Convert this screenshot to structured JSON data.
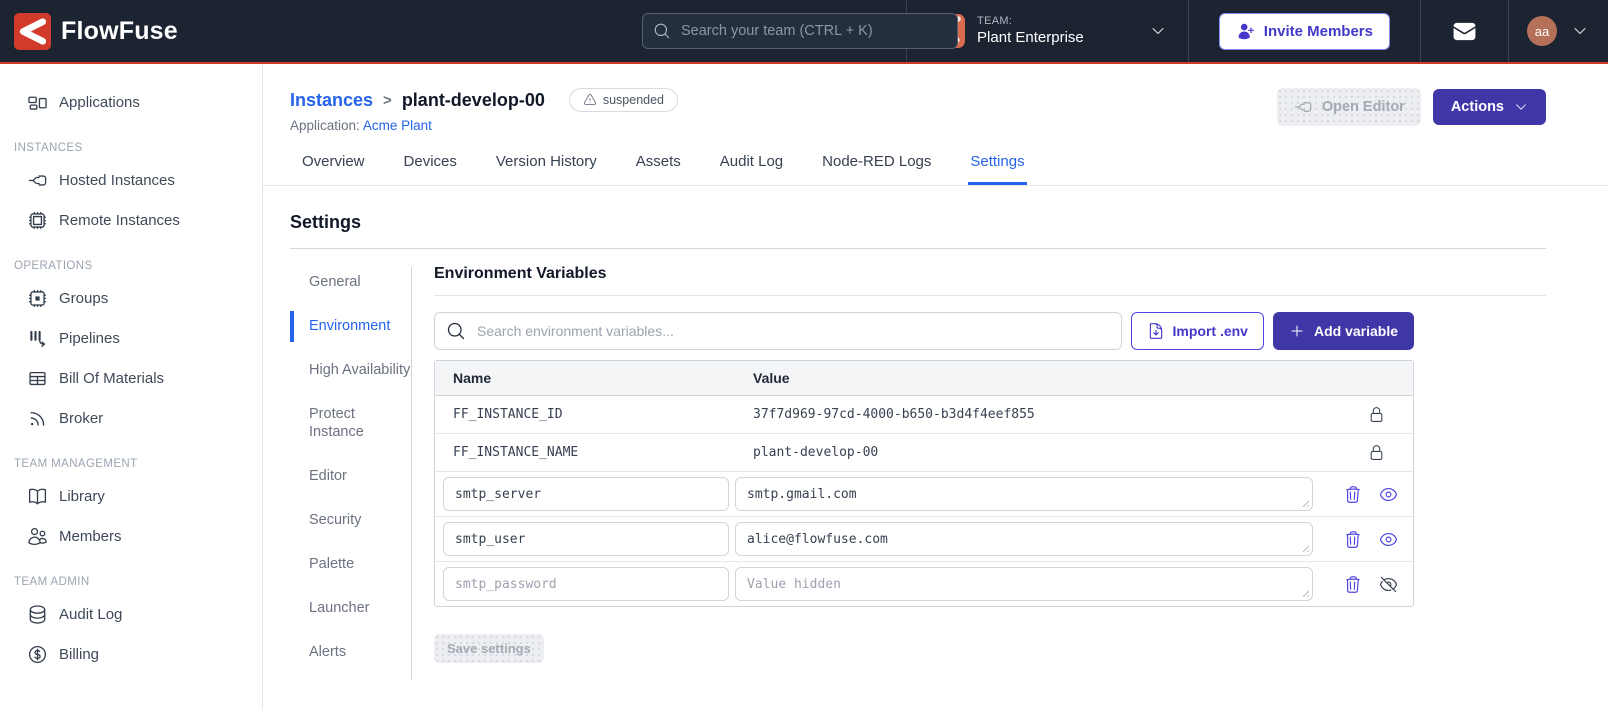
{
  "header": {
    "brand": "FlowFuse",
    "search_placeholder": "Search your team (CTRL + K)",
    "team_label": "TEAM:",
    "team_name": "Plant Enterprise",
    "invite_button": "Invite Members",
    "avatar_initials": "aa"
  },
  "sidebar": {
    "sections": [
      {
        "label": "",
        "items": [
          {
            "label": "Applications",
            "icon": "applications-icon"
          }
        ]
      },
      {
        "label": "INSTANCES",
        "items": [
          {
            "label": "Hosted Instances",
            "icon": "hosted-instances-icon"
          },
          {
            "label": "Remote Instances",
            "icon": "remote-instances-icon"
          }
        ]
      },
      {
        "label": "OPERATIONS",
        "items": [
          {
            "label": "Groups",
            "icon": "groups-icon"
          },
          {
            "label": "Pipelines",
            "icon": "pipelines-icon"
          },
          {
            "label": "Bill Of Materials",
            "icon": "bill-of-materials-icon"
          },
          {
            "label": "Broker",
            "icon": "broker-icon"
          }
        ]
      },
      {
        "label": "TEAM MANAGEMENT",
        "items": [
          {
            "label": "Library",
            "icon": "library-icon"
          },
          {
            "label": "Members",
            "icon": "members-icon"
          }
        ]
      },
      {
        "label": "TEAM ADMIN",
        "items": [
          {
            "label": "Audit Log",
            "icon": "audit-log-icon"
          },
          {
            "label": "Billing",
            "icon": "billing-icon"
          }
        ]
      }
    ]
  },
  "page": {
    "breadcrumb_parent": "Instances",
    "breadcrumb_separator": ">",
    "breadcrumb_current": "plant-develop-00",
    "status_badge": "suspended",
    "application_label": "Application:",
    "application_name": "Acme Plant",
    "open_editor_button": "Open Editor",
    "actions_button": "Actions",
    "tabs": [
      "Overview",
      "Devices",
      "Version History",
      "Assets",
      "Audit Log",
      "Node-RED Logs",
      "Settings"
    ],
    "active_tab": "Settings"
  },
  "settings": {
    "title": "Settings",
    "nav": [
      "General",
      "Environment",
      "High Availability",
      "Protect Instance",
      "Editor",
      "Security",
      "Palette",
      "Launcher",
      "Alerts"
    ],
    "active_nav": "Environment",
    "section_title": "Environment Variables",
    "search_placeholder": "Search environment variables...",
    "import_button": "Import .env",
    "add_button": "Add variable",
    "table": {
      "columns": [
        "Name",
        "Value"
      ],
      "locked_rows": [
        {
          "name": "FF_INSTANCE_ID",
          "value": "37f7d969-97cd-4000-b650-b3d4f4eef855"
        },
        {
          "name": "FF_INSTANCE_NAME",
          "value": "plant-develop-00"
        }
      ],
      "editable_rows": [
        {
          "name": "smtp_server",
          "value": "smtp.gmail.com",
          "hidden": false
        },
        {
          "name": "smtp_user",
          "value": "alice@flowfuse.com",
          "hidden": false
        },
        {
          "name": "smtp_password",
          "value": "",
          "value_placeholder": "Value hidden",
          "hidden": true
        }
      ]
    },
    "save_button": "Save settings"
  },
  "colors": {
    "header_bg": "#1c2432",
    "brand_red": "#d23b2c",
    "accent_indigo": "#3f37a8",
    "link_blue": "#2563eb",
    "team_avatar": "#d96a4f",
    "user_avatar": "#b5705a"
  }
}
